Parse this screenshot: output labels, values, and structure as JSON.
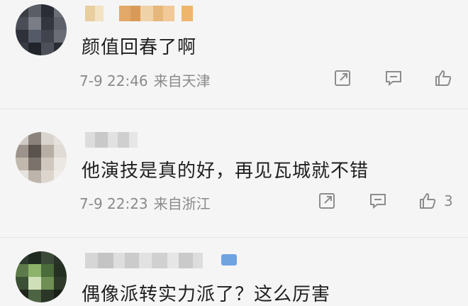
{
  "comments": [
    {
      "text": "颜值回春了啊",
      "date": "7-9 22:46",
      "location": "来自天津",
      "likes": ""
    },
    {
      "text": "他演技是真的好，再见瓦城就不错",
      "date": "7-9 22:23",
      "location": "来自浙江",
      "likes": "3"
    },
    {
      "text": "偶像派转实力派了？这么厉害",
      "date": "",
      "location": "",
      "likes": ""
    }
  ],
  "icons": {
    "share": "share-icon",
    "reply": "comment-icon",
    "like": "thumbs-up-icon"
  },
  "colors": {
    "background": "#f5f5f5",
    "meta_text": "#8a8a8a",
    "icon": "#8c8c8c"
  }
}
